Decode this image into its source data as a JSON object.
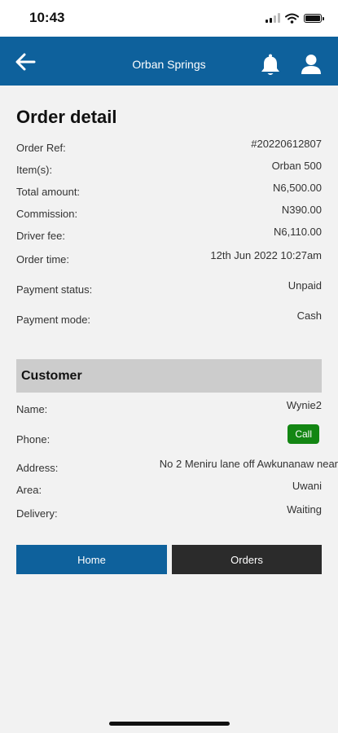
{
  "status_bar": {
    "time": "10:43"
  },
  "header": {
    "title": "Orban Springs"
  },
  "order": {
    "title": "Order detail",
    "fields": [
      {
        "label": "Order Ref:",
        "value": "#20220612807"
      },
      {
        "label": "Item(s):",
        "value": "Orban 500"
      },
      {
        "label": "Total amount:",
        "value": "N6,500.00"
      },
      {
        "label": "Commission:",
        "value": "N390.00"
      },
      {
        "label": "Driver fee:",
        "value": "N6,110.00"
      },
      {
        "label": "Order time:",
        "value": "12th Jun 2022 10:27am"
      },
      {
        "label": "Payment status:",
        "value": "Unpaid"
      },
      {
        "label": "Payment mode:",
        "value": "Cash"
      }
    ]
  },
  "customer": {
    "title": "Customer",
    "name": {
      "label": "Name:",
      "value": "Wynie2"
    },
    "phone": {
      "label": "Phone:",
      "button": "Call"
    },
    "address": {
      "label": "Address:",
      "value": "No 2 Meniru lane off Awkunanaw near"
    },
    "area": {
      "label": "Area:",
      "value": "Uwani"
    },
    "delivery": {
      "label": "Delivery:",
      "value": "Waiting"
    }
  },
  "buttons": {
    "home": "Home",
    "orders": "Orders"
  },
  "colors": {
    "primary": "#0e619c",
    "call": "#138613",
    "dark_button": "#2b2b2b",
    "section_bg": "#cccccc"
  }
}
